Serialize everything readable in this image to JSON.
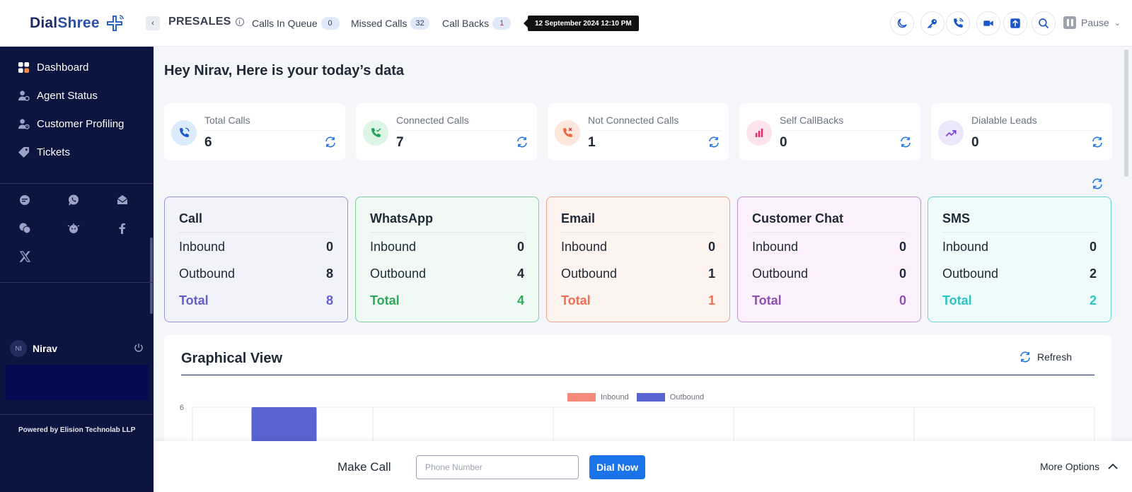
{
  "header": {
    "logo_dial": "Dial",
    "logo_shree": "Shree",
    "campaign": "PRESALES",
    "calls_in_queue_label": "Calls In Queue",
    "calls_in_queue_count": "0",
    "missed_calls_label": "Missed Calls",
    "missed_calls_count": "32",
    "call_backs_label": "Call Backs",
    "call_backs_count": "1",
    "datetime": "12 September 2024 12:10 PM",
    "pause_label": "Pause"
  },
  "sidebar": {
    "items": [
      {
        "label": "Dashboard"
      },
      {
        "label": "Agent Status"
      },
      {
        "label": "Customer Profiling"
      },
      {
        "label": "Tickets"
      }
    ],
    "user": {
      "initials": "NI",
      "name": "Nirav"
    },
    "powered_by": "Powered by Elision Technolab LLP"
  },
  "main": {
    "greeting": "Hey Nirav, Here is your today’s data",
    "kpis": [
      {
        "label": "Total Calls",
        "value": "6"
      },
      {
        "label": "Connected Calls",
        "value": "7"
      },
      {
        "label": "Not Connected Calls",
        "value": "1"
      },
      {
        "label": "Self CallBacks",
        "value": "0"
      },
      {
        "label": "Dialable Leads",
        "value": "0"
      }
    ],
    "channels": [
      {
        "title": "Call",
        "inbound_label": "Inbound",
        "inbound": "0",
        "outbound_label": "Outbound",
        "outbound": "8",
        "total_label": "Total",
        "total": "8",
        "color": "#6a5bd1"
      },
      {
        "title": "WhatsApp",
        "inbound_label": "Inbound",
        "inbound": "0",
        "outbound_label": "Outbound",
        "outbound": "4",
        "total_label": "Total",
        "total": "4",
        "color": "#2faa5b"
      },
      {
        "title": "Email",
        "inbound_label": "Inbound",
        "inbound": "0",
        "outbound_label": "Outbound",
        "outbound": "1",
        "total_label": "Total",
        "total": "1",
        "color": "#ee7052"
      },
      {
        "title": "Customer Chat",
        "inbound_label": "Inbound",
        "inbound": "0",
        "outbound_label": "Outbound",
        "outbound": "0",
        "total_label": "Total",
        "total": "0",
        "color": "#8e4fb5"
      },
      {
        "title": "SMS",
        "inbound_label": "Inbound",
        "inbound": "0",
        "outbound_label": "Outbound",
        "outbound": "2",
        "total_label": "Total",
        "total": "2",
        "color": "#2ec4c4"
      }
    ],
    "graph": {
      "title": "Graphical View",
      "refresh_label": "Refresh"
    }
  },
  "chart_data": {
    "type": "bar",
    "series": [
      {
        "name": "Inbound",
        "color": "#f58a7a",
        "values": [
          0,
          0,
          0,
          0,
          0
        ]
      },
      {
        "name": "Outbound",
        "color": "#5b63d3",
        "values": [
          6,
          null,
          null,
          null,
          null
        ]
      }
    ],
    "y_ticks": [
      "6"
    ],
    "ylim": [
      0,
      6
    ],
    "grid": true,
    "legend": "top-center",
    "note_visible": "chart is cropped at bottom; only the top of the first Outbound bar at 6 is visible"
  },
  "bottombar": {
    "make_call_label": "Make Call",
    "phone_placeholder": "Phone Number",
    "dial_label": "Dial Now",
    "more_options_label": "More Options"
  },
  "colors": {
    "sidebar_bg": "#0c1440",
    "accent_blue": "#1a73e8",
    "brand_navy": "#1c2c6b"
  }
}
